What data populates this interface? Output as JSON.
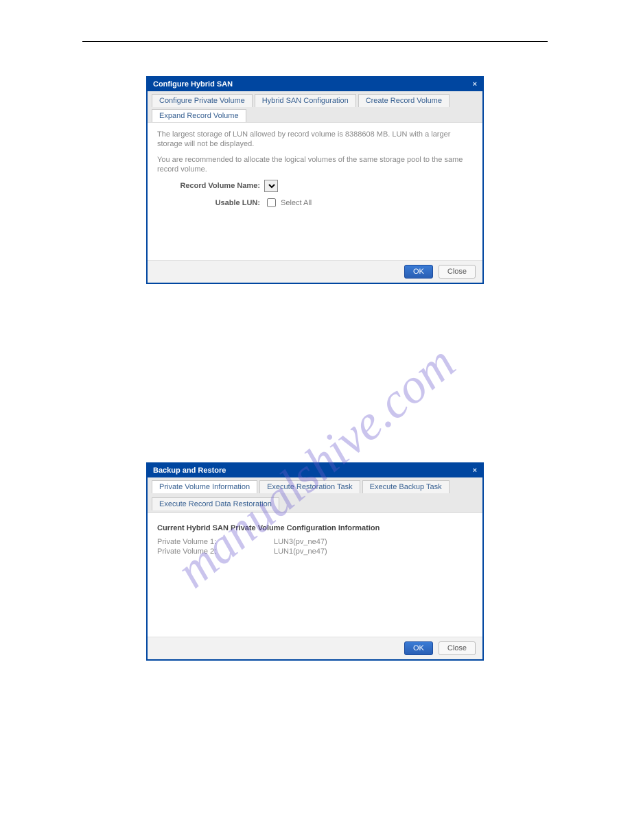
{
  "dialog1": {
    "title": "Configure Hybrid SAN",
    "tabs": [
      "Configure Private Volume",
      "Hybrid SAN Configuration",
      "Create Record Volume",
      "Expand Record Volume"
    ],
    "active_tab_index": 3,
    "info1": "The largest storage of LUN allowed by record volume is 8388608 MB. LUN with a larger storage will not be displayed.",
    "info2": "You are recommended to allocate the logical volumes of the same storage pool to the same record volume.",
    "record_volume_label": "Record Volume Name:",
    "usable_lun_label": "Usable LUN:",
    "select_all_label": "Select All",
    "ok_label": "OK",
    "close_label": "Close"
  },
  "dialog2": {
    "title": "Backup and Restore",
    "tabs": [
      "Private Volume Information",
      "Execute Restoration Task",
      "Execute Backup Task",
      "Execute Record Data Restoration"
    ],
    "active_tab_index": 0,
    "section_heading": "Current Hybrid SAN Private Volume Configuration Information",
    "rows": [
      {
        "label": "Private Volume  1:",
        "value": "LUN3(pv_ne47)"
      },
      {
        "label": "Private Volume  2:",
        "value": "LUN1(pv_ne47)"
      }
    ],
    "ok_label": "OK",
    "close_label": "Close"
  },
  "watermark_text": "manualshive.com"
}
